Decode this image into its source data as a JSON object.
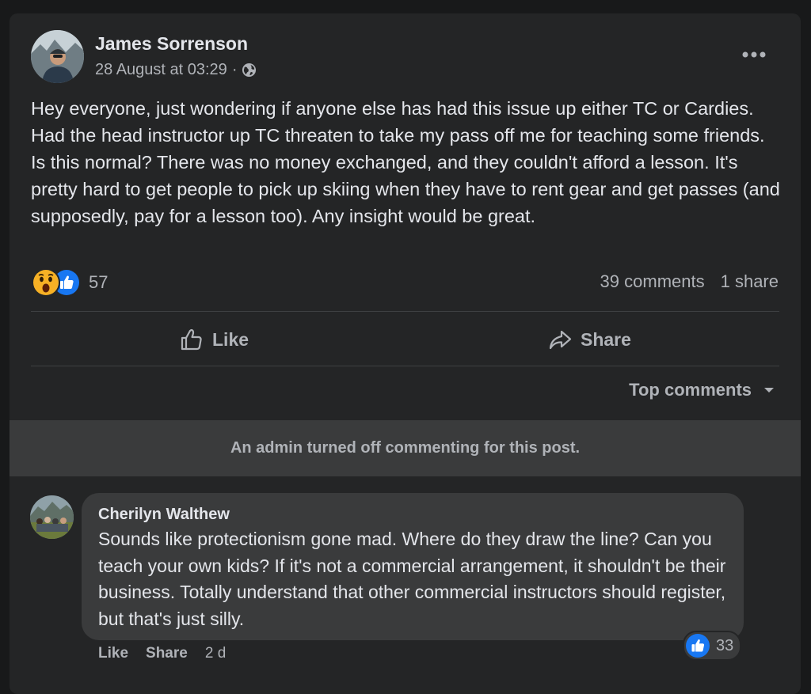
{
  "post": {
    "author": "James Sorrenson",
    "timestamp": "28 August at 03:29",
    "separator": "·",
    "privacy_icon": "globe-icon",
    "more_icon": "more-dots-icon",
    "text": "Hey everyone, just wondering if anyone else has had this issue up either TC or Cardies. Had the head instructor up TC threaten to take my pass off me for teaching some friends. Is this normal? There was no money exchanged, and they couldn't afford a lesson. It's pretty hard to get people to pick up skiing when they have to rent gear and get passes (and supposedly, pay for a lesson too). Any insight would be great.",
    "reactions": {
      "icons": [
        "wow-icon",
        "like-icon"
      ],
      "count": "57"
    },
    "comments_count": "39 comments",
    "shares_count": "1 share",
    "actions": {
      "like_label": "Like",
      "share_label": "Share"
    },
    "sort_label": "Top comments",
    "admin_notice": "An admin turned off commenting for this post."
  },
  "comment": {
    "author": "Cherilyn Walthew",
    "text": "Sounds like protectionism gone mad. Where do they draw the line? Can you teach your own kids? If it's not a commercial arrangement, it shouldn't be their business. Totally understand that other commercial instructors should register, but that's just silly.",
    "like_count": "33",
    "actions": {
      "like_label": "Like",
      "share_label": "Share",
      "time": "2 d"
    }
  },
  "colors": {
    "page_bg": "#18191a",
    "card_bg": "#242526",
    "bubble_bg": "#3a3b3c",
    "primary_text": "#e4e6eb",
    "secondary_text": "#b0b3b8",
    "like_blue": "#1877f2",
    "wow_yellow": "#f7b125"
  }
}
